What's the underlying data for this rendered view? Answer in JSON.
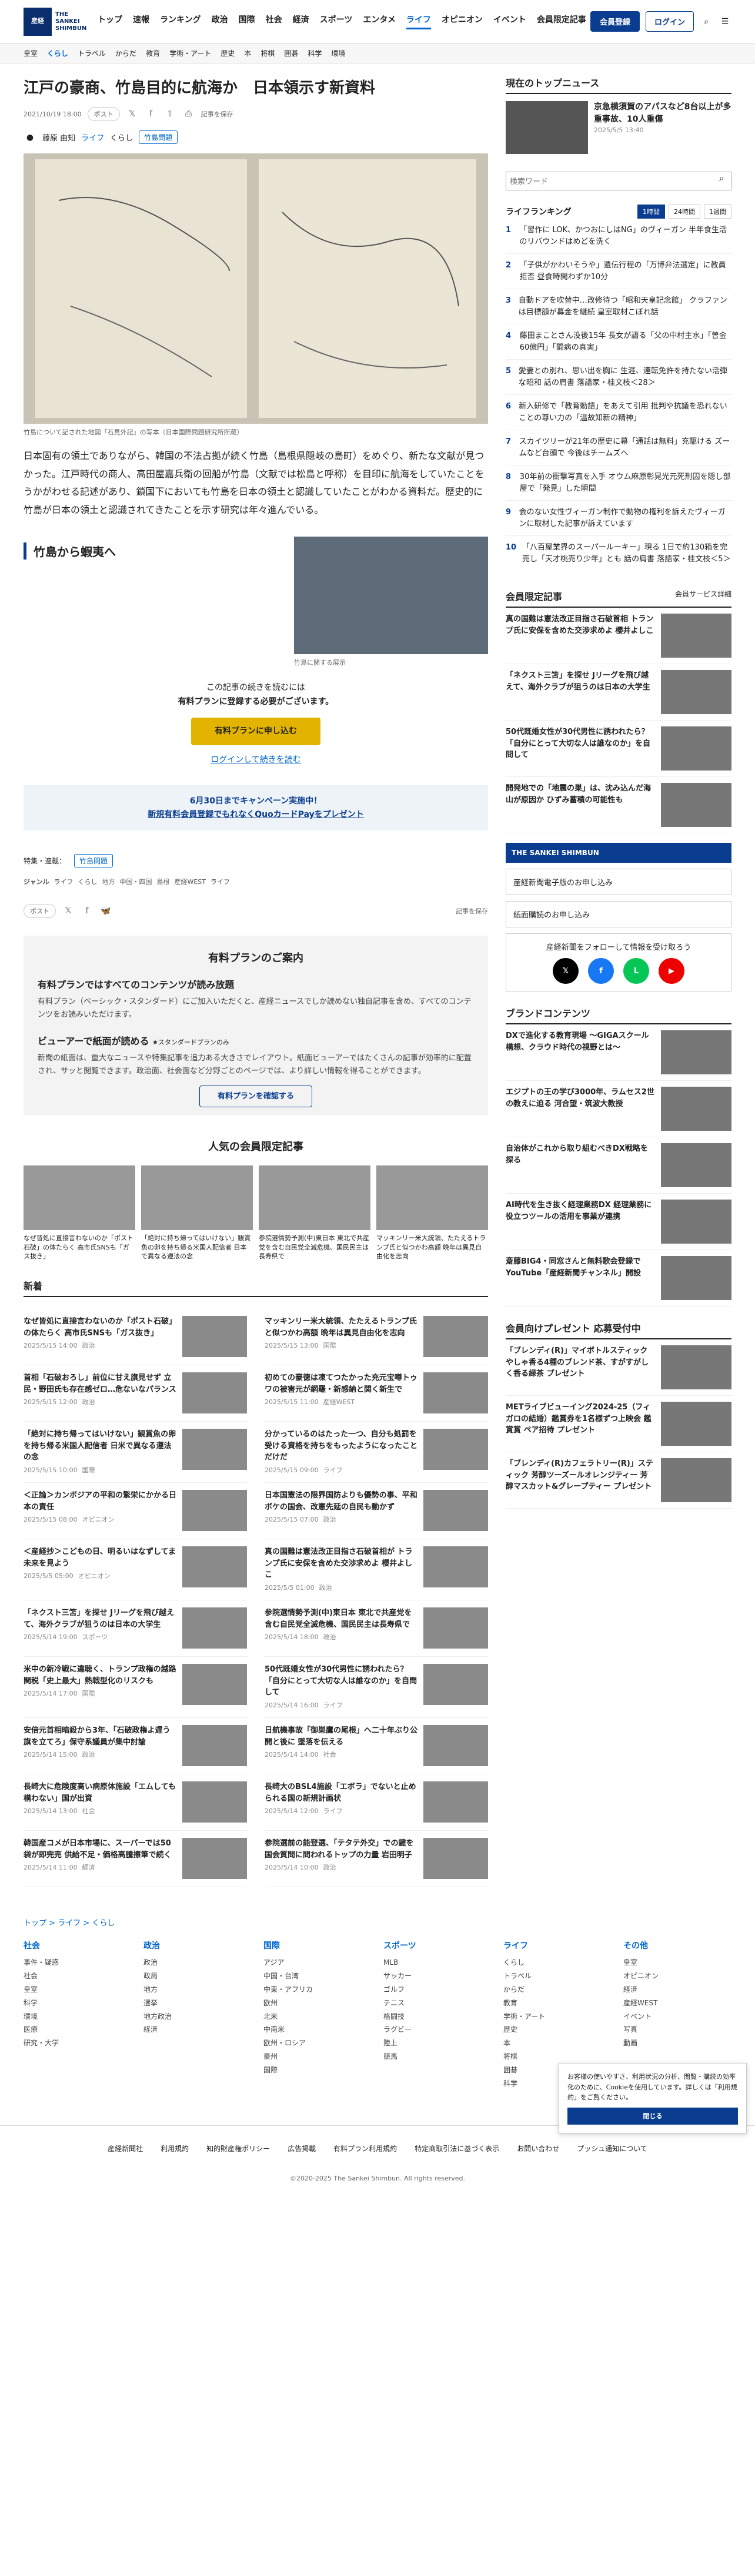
{
  "header": {
    "logo_line1": "産経",
    "logo_line2": "新聞",
    "logo_sub": "THE SANKEI SHIMBUN",
    "nav": [
      "トップ",
      "速報",
      "ランキング",
      "政治",
      "国際",
      "社会",
      "経済",
      "スポーツ",
      "エンタメ",
      "ライフ",
      "オピニオン",
      "イベント",
      "会員限定記事"
    ],
    "active": "ライフ",
    "register": "会員登録",
    "login": "ログイン",
    "menu": "MENU"
  },
  "subnav": [
    "皇室",
    "くらし",
    "トラベル",
    "からだ",
    "教育",
    "学術・アート",
    "歴史",
    "本",
    "将棋",
    "囲碁",
    "科学",
    "環境"
  ],
  "article": {
    "title": "江戸の豪商、竹島目的に航海か　日本領示す新資料",
    "date": "2021/10/19 18:00",
    "share": "ポスト",
    "save": "記事を保存",
    "author": "藤原 由知",
    "category": "ライフ",
    "subcategory": "くらし",
    "tag": "竹島問題",
    "caption": "竹島について記された地図「石見外記」の写本（日本国際問題研究所所蔵）",
    "p1": "日本固有の領土でありながら、韓国の不法占拠が続く竹島（島根県隠岐の島町）をめぐり、新たな文献が見つかった。江戸時代の商人、高田屋嘉兵衛の回船が竹島（文献では松島と呼称）を目印に航海をしていたことをうかがわせる記述があり、鎖国下においても竹島を日本の領土と認識していたことがわかる資料だ。歴史的に竹島が日本の領土と認識されてきたことを示す研究は年々進んでいる。",
    "h2": "竹島から蝦夷へ",
    "photo2_caption": "竹島に関する展示",
    "paywall1": "この記事の続きを読むには",
    "paywall2": "有料プランに登録する必要がございます。",
    "apply": "有料プランに申し込む",
    "login_read": "ログインして続きを読む",
    "campaign1": "6月30日までキャンペーン実施中！",
    "campaign2": "新規有料会員登録でもれなくQuoカードPayをプレゼント",
    "tag_label": "特集・連載：",
    "genre_label": "ジャンル",
    "genres": [
      "ライフ",
      "くらし",
      "地方",
      "中国・四国",
      "島根",
      "産経WEST",
      "ライフ"
    ]
  },
  "plan": {
    "title": "有料プランのご案内",
    "h1": "有料プランではすべてのコンテンツが読み放題",
    "p1": "有料プラン（ベーシック・スタンダード）にご加入いただくと、産経ニュースでしか読めない独自記事を含め、すべてのコンテンツをお読みいただけます。",
    "h2": "ビューアーで紙面が読める",
    "h2b": "★スタンダードプランのみ",
    "p2": "新聞の紙面は、重大なニュースや特集記事を追力ある大きさでレイアウト。紙面ビューアーではたくさんの記事が効率的に配置され、サッと閲覧できます。政治面、社会面など分野ごとのページでは、より詳しい情報を得ることができます。",
    "btn": "有料プランを確認する"
  },
  "popular": {
    "title": "人気の会員限定記事",
    "items": [
      "なぜ皆処に直接言わないのか「ポスト石破」の体たらく 高市氏SNSも「ガス抜き」",
      "「絶対に持ち帰ってはいけない」観賞魚の卵を持ち帰る米国人配信者 日本で異なる遵法の念",
      "参院選情勢予測(中)東日本 東北で共産党を含む自民党全滅危機、国民民主は長寿県で",
      "マッキンリー米大統領、たたえるトランプ氏と似つかわ高額 晩年は異見自由化を志向"
    ]
  },
  "news_title": "新着",
  "news": [
    [
      "なぜ皆処に直接言わないのか「ポスト石破」の体たらく 高市氏SNSも「ガス抜き」",
      "2025/5/15 14:00",
      "政治"
    ],
    [
      "マッキンリー米大統領、たたえるトランプ氏と似つかわ高額 晩年は異見自由化を志向",
      "2025/5/15 13:00",
      "国際"
    ],
    [
      "首相「石破おろし」前位に甘え旗見せず 立民・野田氏も存在感ゼロ…危ないなパランス",
      "2025/5/15 12:00",
      "政治"
    ],
    [
      "初めての豪徳は凍てつたかった充元宝噂トゥワの被害元が網羅・新感納と関く新生で",
      "2025/5/15 11:00",
      "産経WEST"
    ],
    [
      "「絶対に持ち帰ってはいけない」観賞魚の卵を持ち帰る米国人配信者 日米で異なる遵法の念",
      "2025/5/15 10:00",
      "国際"
    ],
    [
      "分かっているのはたった一つ、自分も処罰を受ける資格を持ちをもったようになったことだけだ",
      "2025/5/15 09:00",
      "ライフ"
    ],
    [
      "＜正論＞カンボジアの平和の繁栄にかかる日本の責任",
      "2025/5/15 08:00",
      "オピニオン"
    ],
    [
      "日本国憲法の限界国防よりも優勢の事、平和ボケの国会、改憲先延の自民も動かず",
      "2025/5/15 07:00",
      "政治"
    ],
    [
      "＜産経抄＞こどもの日、明るいはなずしてま未来を見よう",
      "2025/5/5 05:00",
      "オピニオン"
    ],
    [
      "真の国難は憲法改正目指さ石破首相が トランプ氏に安保を含めた交渉求めよ 櫻井よしこ",
      "2025/5/5 01:00",
      "政治"
    ],
    [
      "「ネクスト三笘」を探せ Jリーグを飛び越えて、海外クラブが狙うのは日本の大学生",
      "2025/5/14 19:00",
      "スポーツ"
    ],
    [
      "参院選情勢予測(中)東日本 東北で共産党を含む自民党全滅危機、国民民主は長寿県で",
      "2025/5/14 18:00",
      "政治"
    ],
    [
      "米中の新冷戦に違聴く、トランプ政権の越路関税「史上最大」熱戦型化のリスクも",
      "2025/5/14 17:00",
      "国際"
    ],
    [
      "50代既婚女性が30代男性に誘われたら？「自分にとって大切な人は誰なのか」を自問して",
      "2025/5/14 16:00",
      "ライフ"
    ],
    [
      "安倍元首相暗殺から3年、「石破政権よ遅う旗を立てろ」保守系議員が集中討論",
      "2025/5/14 15:00",
      "政治"
    ],
    [
      "日航機事故「御巣鷹の尾根」へ二十年ぶり公開と後に 墜落を伝える",
      "2025/5/14 14:00",
      "社会"
    ],
    [
      "長崎大に危険度高い病原体施設「エムしても構わない」国が出資",
      "2025/5/14 13:00",
      "社会"
    ],
    [
      "長崎大のBSL4施設「エボラ」でないと止められる国の新規計画状",
      "2025/5/14 12:00",
      "ライフ"
    ],
    [
      "韓国産コメが日本市場に、スーパーでは50袋が即完売 供給不足・価格高騰擦筆で続く",
      "2025/5/14 11:00",
      "経済"
    ],
    [
      "参院選前の能登選、「テタテ外交」での鍵を国会質問に問われるトップの力量 岩田明子",
      "2025/5/14 10:00",
      "政治"
    ]
  ],
  "side": {
    "top_title": "現在のトップニュース",
    "top_item": "京急横須賀のアパスなど8台以上が多重事故、10人重傷",
    "top_date": "2025/5/5 13:40",
    "search_placeholder": "検索ワード",
    "rank_title": "ライフランキング",
    "rank_tabs": [
      "1時間",
      "24時間",
      "1週間"
    ],
    "rank": [
      "「習作に LOK、かつおにしはNG」のヴィーガン 半年食生活のリバウンドはめどを洗く",
      "「子供がかわいそうや」遺伝行程の「万博弁法選定」に教員拒否 昼食時間わずか10分",
      "自動ドアを吹替中…改修待つ「昭和天皇記念館」 クラファンは目標額が募金を継続 皇室取材こぼれ話",
      "藤田まことさん没後15年 長女が語る「父の中村主水」「曽金60億円」「闘病の真実」",
      "愛妻との別れ、思い出を胸に 生涯、連転免許を持たない活弾な昭和 話の肩書 落語家・桂文枝＜28＞",
      "新入研修で「教育勅語」をあえて引用 批判や抗議を恐れないことの尊い力の「温故知新の精神」",
      "スカイツリーが21年の歴史に幕「通話は無料」充駆ける ズームなど台頭で 今後はチームズへ",
      "30年前の衝撃写真を入手 オウム麻原彰晃光元死刑囚を隠し部屋で「発見」した瞬間",
      "会のない女性ヴィーガン制作で動物の権利を訴えたヴィーガンに取材した記事が訴えています",
      "「八百屋業界のスーパールーキー」現る 1日で約130箱を完売し「天才桃売り少年」とも 話の肩書 落語家・桂文枝＜5＞"
    ],
    "member_title": "会員限定記事",
    "member_more": "会員サービス詳細",
    "members": [
      "真の国難は憲法改正目指さ石破首相 トランプ氏に安保を含めた交渉求めよ 櫻井よしこ",
      "「ネクスト三笘」を探せ Jリーグを飛び越えて、海外クラブが狙うのは日本の大学生",
      "50代既婚女性が30代男性に誘われたら？「自分にとって大切な人は誰なのか」を自問して",
      "開発地での「地震の巣」は、沈み込んだ海山が原因か ひずみ蓄積の可能性も"
    ],
    "sankei_box": "THE SANKEI SHIMBUN",
    "order": "産経新聞電子版のお申し込み",
    "order2": "紙面購読のお申し込み",
    "follow": "産経新聞をフォローして情報を受け取ろう",
    "brand_title": "ブランドコンテンツ",
    "brands": [
      "DXで進化する教育現場 〜GIGAスクール構想、クラウド時代の視野とは〜",
      "エジプトの王の学び3000年、ラムセス2世の教えに迫る 河合望・筑波大教授",
      "自治体がこれから取り組むべきDX戦略を探る",
      "AI時代を生き抜く経理業務DX 経理業務に役立つツールの活用を事業が連携",
      "斎藤BIG4・同窓さんと無料歌会登録でYouTube「産経新聞チャンネル」開設"
    ],
    "present_title": "会員向けプレゼント 応募受付中",
    "presents": [
      "「ブレンディ(R)」マイボトルスティック やしゃ香る4種のブレンド茶、すがすがしく香る緑茶 プレゼント",
      "METライブビューイング2024-25（フィガロの結婚）鑑賞券を1名様ずつ上映会 鑑賞賞 ペア招待 プレゼント",
      "「ブレンディ(R)カフェラトリー(R)」スティック 芳醇ツーズールオレンジティー 芳醇マスカット&グレープティー プレゼント"
    ]
  },
  "cookie": {
    "text": "お客様の使いやすさ、利用状況の分析、閲覧・購読の効率化のために、Cookieを使用しています。詳しくは「利用規約」をご覧ください。",
    "close": "閉じる"
  },
  "breadcrumb": [
    "トップ",
    "ライフ",
    "くらし"
  ],
  "footer": [
    {
      "h": "社会",
      "i": [
        "事件・疑惑",
        "社会",
        "皇室",
        "科学",
        "環境",
        "医療",
        "研究・大学"
      ]
    },
    {
      "h": "政治",
      "i": [
        "政治",
        "政局",
        "地方",
        "選挙",
        "地方政治",
        "経済"
      ]
    },
    {
      "h": "国際",
      "i": [
        "アジア",
        "中国・台湾",
        "中東・アフリカ",
        "欧州",
        "北米",
        "中南米",
        "欧州・ロシア",
        "豪州",
        "国際"
      ]
    },
    {
      "h": "スポーツ",
      "i": [
        "MLB",
        "サッカー",
        "ゴルフ",
        "テニス",
        "格闘技",
        "ラグビー",
        "陸上",
        "競馬"
      ]
    },
    {
      "h": "ライフ",
      "i": [
        "くらし",
        "トラベル",
        "からだ",
        "教育",
        "学術・アート",
        "歴史",
        "本",
        "将棋",
        "囲碁",
        "科学"
      ]
    },
    {
      "h": "その他",
      "i": [
        "皇室",
        "オピニオン",
        "経済",
        "産経WEST",
        "イベント",
        "写真",
        "動画"
      ]
    }
  ],
  "footer_links": [
    "産経新聞社",
    "利用規約",
    "知的財産権ポリシー",
    "広告掲載",
    "有料プラン利用規約",
    "特定商取引法に基づく表示",
    "お問い合わせ",
    "プッシュ通知について"
  ],
  "copyright": "©2020-2025 The Sankei Shimbun. All rights reserved."
}
